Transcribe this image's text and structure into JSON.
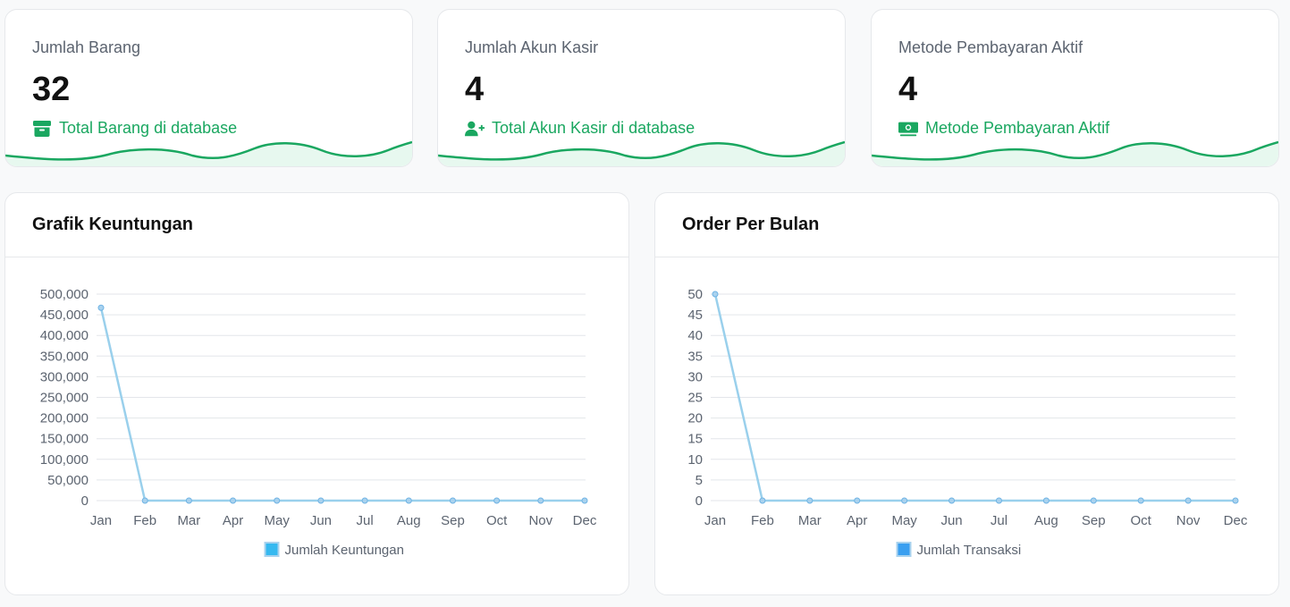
{
  "stats": [
    {
      "label": "Jumlah Barang",
      "value": "32",
      "sub": "Total Barang di database",
      "icon": "archive-icon"
    },
    {
      "label": "Jumlah Akun Kasir",
      "value": "4",
      "sub": "Total Akun Kasir di database",
      "icon": "user-plus-icon"
    },
    {
      "label": "Metode Pembayaran Aktif",
      "value": "4",
      "sub": "Metode Pembayaran Aktif",
      "icon": "money-bill-icon"
    }
  ],
  "colors": {
    "accent_green": "#1aa760",
    "wave_fill": "#e7f8ef",
    "line_series": "#9ad0ec",
    "legend_profit": "#36b9f0",
    "legend_orders": "#3a9ff0"
  },
  "chart_data": [
    {
      "type": "line",
      "title": "Grafik Keuntungan",
      "categories": [
        "Jan",
        "Feb",
        "Mar",
        "Apr",
        "May",
        "Jun",
        "Jul",
        "Aug",
        "Sep",
        "Oct",
        "Nov",
        "Dec"
      ],
      "series": [
        {
          "name": "Jumlah Keuntungan",
          "values": [
            467000,
            0,
            0,
            0,
            0,
            0,
            0,
            0,
            0,
            0,
            0,
            0
          ]
        }
      ],
      "ylim": [
        0,
        500000
      ],
      "yticks": [
        "500,000",
        "450,000",
        "400,000",
        "350,000",
        "300,000",
        "250,000",
        "200,000",
        "150,000",
        "100,000",
        "50,000",
        "0"
      ],
      "grid": true,
      "legend": "bottom"
    },
    {
      "type": "line",
      "title": "Order Per Bulan",
      "categories": [
        "Jan",
        "Feb",
        "Mar",
        "Apr",
        "May",
        "Jun",
        "Jul",
        "Aug",
        "Sep",
        "Oct",
        "Nov",
        "Dec"
      ],
      "series": [
        {
          "name": "Jumlah Transaksi",
          "values": [
            50,
            0,
            0,
            0,
            0,
            0,
            0,
            0,
            0,
            0,
            0,
            0
          ]
        }
      ],
      "ylim": [
        0,
        50
      ],
      "yticks": [
        "50",
        "45",
        "40",
        "35",
        "30",
        "25",
        "20",
        "15",
        "10",
        "5",
        "0"
      ],
      "grid": true,
      "legend": "bottom"
    }
  ]
}
